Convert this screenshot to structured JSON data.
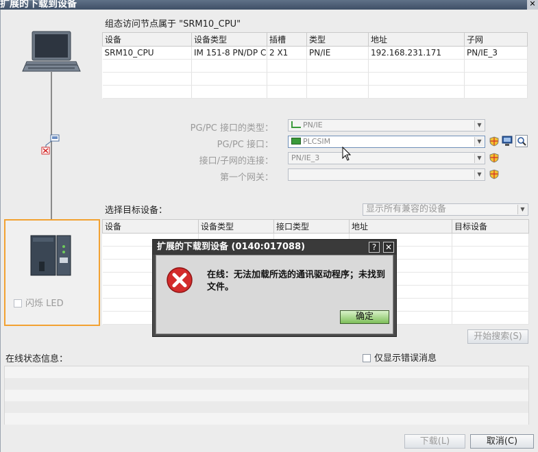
{
  "window": {
    "title": "扩展的下载到设备",
    "close_glyph": "✕"
  },
  "node_section": {
    "heading": "组态访问节点属于 \"SRM10_CPU\"",
    "columns": [
      "设备",
      "设备类型",
      "插槽",
      "类型",
      "地址",
      "子网"
    ],
    "rows": [
      [
        "SRM10_CPU",
        "IM 151-8 PN/DP C...",
        "2 X1",
        "PN/IE",
        "192.168.231.171",
        "PN/IE_3"
      ]
    ]
  },
  "interface": {
    "type_label": "PG/PC 接口的类型：",
    "type_value": "PN/IE",
    "interface_label": "PG/PC 接口：",
    "interface_value": "PLCSIM",
    "subnet_label": "接口/子网的连接：",
    "subnet_value": "PN/IE_3",
    "gateway_label": "第一个网关：",
    "gateway_value": ""
  },
  "target": {
    "label": "选择目标设备：",
    "filter_value": "显示所有兼容的设备",
    "columns": [
      "设备",
      "设备类型",
      "接口类型",
      "地址",
      "目标设备"
    ]
  },
  "flash_led": {
    "label": "闪烁 LED"
  },
  "search_button": "开始搜索(S)",
  "online_status": {
    "label": "在线状态信息：",
    "errors_only_label": "仅显示错误消息"
  },
  "footer": {
    "download_button": "下载(L)",
    "cancel_button": "取消(C)"
  },
  "dialog": {
    "title": "扩展的下载到设备 (0140:017088)",
    "help_glyph": "?",
    "close_glyph": "✕",
    "message": "在线：无法加载所选的通讯驱动程序；未找到文件。",
    "ok_button": "确定"
  },
  "colors": {
    "accent_orange": "#f2a131",
    "error_red": "#d32b2b",
    "ok_green": "#7fbf5a"
  }
}
